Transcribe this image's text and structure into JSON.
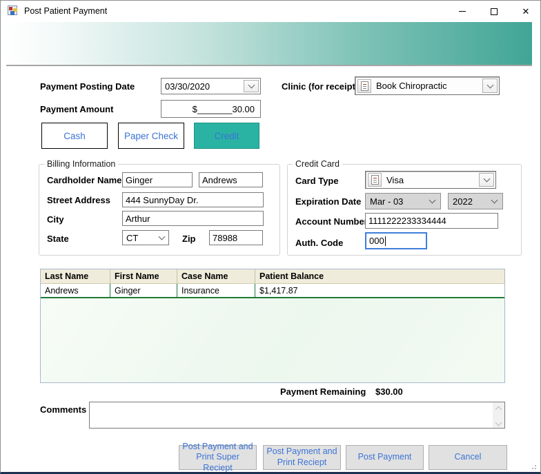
{
  "window": {
    "title": "Post Patient Payment"
  },
  "form": {
    "posting_date": {
      "label": "Payment Posting Date",
      "value": "03/30/2020"
    },
    "clinic": {
      "label": "Clinic (for receipt)",
      "value": "Book Chiropractic"
    },
    "amount": {
      "label": "Payment Amount",
      "value": "$_______30.00"
    },
    "payment_methods": {
      "cash": "Cash",
      "paper_check": "Paper Check",
      "credit": "Credit"
    },
    "billing": {
      "group_label": "Billing Information",
      "cardholder_label": "Cardholder Name",
      "first_name": "Ginger",
      "last_name": "Andrews",
      "street_label": "Street Address",
      "street": "444 SunnyDay Dr.",
      "city_label": "City",
      "city": "Arthur",
      "state_label": "State",
      "state": "CT",
      "zip_label": "Zip",
      "zip": "78988"
    },
    "credit_card": {
      "group_label": "Credit Card",
      "card_type_label": "Card Type",
      "card_type": "Visa",
      "expiration_label": "Expiration Date",
      "exp_month": "Mar - 03",
      "exp_year": "2022",
      "account_label": "Account Number",
      "account_number": "1111222233334444",
      "auth_label": "Auth. Code",
      "auth_code": "000"
    }
  },
  "grid": {
    "columns": [
      "Last Name",
      "First Name",
      "Case Name",
      "Patient Balance"
    ],
    "rows": [
      [
        "Andrews",
        "Ginger",
        "Insurance",
        "$1,417.87"
      ]
    ]
  },
  "summary": {
    "remaining_label": "Payment Remaining",
    "remaining_value": "$30.00"
  },
  "comments": {
    "label": "Comments",
    "value": ""
  },
  "actions": {
    "post_super": "Post Payment and Print Super Reciept",
    "post_receipt": "Post Payment and Print Reciept",
    "post": "Post Payment",
    "cancel": "Cancel"
  },
  "colors": {
    "banner_teal": "#41A596",
    "credit_selected_teal": "#2AB3A3",
    "button_text_blue": "#3B73D6",
    "grid_line_green": "#1D7A35",
    "grid_header_beige": "#F0ECDB"
  }
}
